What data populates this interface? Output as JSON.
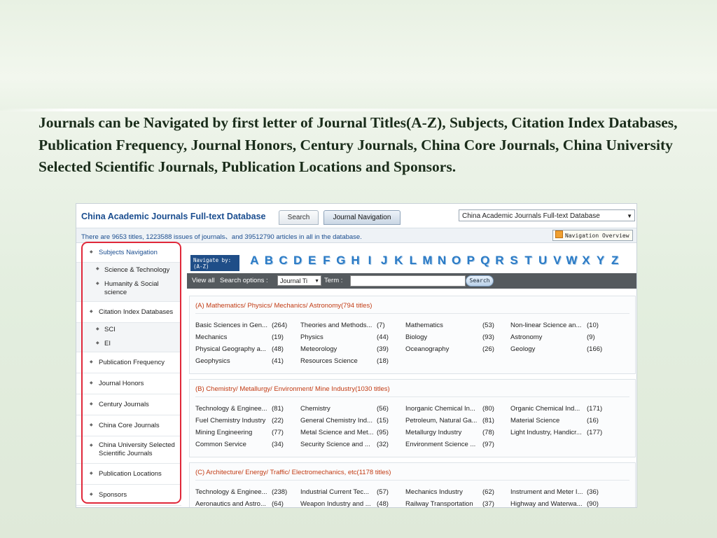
{
  "slide": {
    "heading": "Journals can be Navigated by first letter of Journal Titles(A-Z), Subjects, Citation Index Databases, Publication Frequency, Journal Honors, Century Journals, China Core Journals, China University Selected Scientific Journals, Publication Locations and Sponsors."
  },
  "header": {
    "db_title": "China Academic Journals Full-text Database",
    "tab_search": "Search",
    "tab_nav": "Journal Navigation",
    "db_select": "China Academic Journals Full-text Database"
  },
  "stats": {
    "text": "There are 9653 titles, 1223588 issues of journals、and 39512790 articles in all in the database.",
    "overview": "Navigation Overview"
  },
  "sidebar": {
    "items": [
      {
        "label": "Subjects Navigation"
      },
      {
        "label": "Science & Technology"
      },
      {
        "label": "Humanity & Social science"
      },
      {
        "label": "Citation Index Databases"
      },
      {
        "label": "SCI"
      },
      {
        "label": "EI"
      },
      {
        "label": "Publication Frequency"
      },
      {
        "label": "Journal Honors"
      },
      {
        "label": "Century Journals"
      },
      {
        "label": "China Core Journals"
      },
      {
        "label": "China University Selected Scientific Journals"
      },
      {
        "label": "Publication Locations"
      },
      {
        "label": "Sponsors"
      }
    ]
  },
  "nav": {
    "label_line1": "Navigate by:",
    "label_line2": "(A-Z)",
    "letters": [
      "A",
      "B",
      "C",
      "D",
      "E",
      "F",
      "G",
      "H",
      "I",
      "J",
      "K",
      "L",
      "M",
      "N",
      "O",
      "P",
      "Q",
      "R",
      "S",
      "T",
      "U",
      "V",
      "W",
      "X",
      "Y",
      "Z"
    ]
  },
  "toolbar": {
    "view_all": "View all",
    "search_options": "Search options :",
    "select_value": "Journal Ti",
    "term": "Term :",
    "search_btn": "Search"
  },
  "categories": [
    {
      "title": "(A) Mathematics/ Physics/ Mechanics/ Astronomy(794 titles)",
      "rows": [
        [
          [
            "Basic Sciences in Gen...",
            "(264)"
          ],
          [
            "Theories and Methods...",
            "(7)"
          ],
          [
            "Mathematics",
            "(53)"
          ],
          [
            "Non-linear Science an...",
            "(10)"
          ]
        ],
        [
          [
            "Mechanics",
            "(19)"
          ],
          [
            "Physics",
            "(44)"
          ],
          [
            "Biology",
            "(93)"
          ],
          [
            "Astronomy",
            "(9)"
          ]
        ],
        [
          [
            "Physical Geography a...",
            "(48)"
          ],
          [
            "Meteorology",
            "(39)"
          ],
          [
            "Oceanography",
            "(26)"
          ],
          [
            "Geology",
            "(166)"
          ]
        ],
        [
          [
            "Geophysics",
            "(41)"
          ],
          [
            "Resources Science",
            "(18)"
          ]
        ]
      ]
    },
    {
      "title": "(B) Chemistry/ Metallurgy/ Environment/ Mine Industry(1030 titles)",
      "rows": [
        [
          [
            "Technology & Enginee...",
            "(81)"
          ],
          [
            "Chemistry",
            "(56)"
          ],
          [
            "Inorganic Chemical In...",
            "(80)"
          ],
          [
            "Organic Chemical Ind...",
            "(171)"
          ]
        ],
        [
          [
            "Fuel Chemistry Industry",
            "(22)"
          ],
          [
            "General Chemistry Ind...",
            "(15)"
          ],
          [
            "Petroleum, Natural Ga...",
            "(81)"
          ],
          [
            "Material Science",
            "(16)"
          ]
        ],
        [
          [
            "Mining Engineering",
            "(77)"
          ],
          [
            "Metal Science and Met...",
            "(95)"
          ],
          [
            "Metallurgy Industry",
            "(78)"
          ],
          [
            "Light Industry, Handicr...",
            "(177)"
          ]
        ],
        [
          [
            "Common Service",
            "(34)"
          ],
          [
            "Security Science and ...",
            "(32)"
          ],
          [
            "Environment Science ...",
            "(97)"
          ]
        ]
      ]
    },
    {
      "title": "(C) Architecture/ Energy/ Traffic/ Electromechanics, etc(1178 titles)",
      "rows": [
        [
          [
            "Technology & Enginee...",
            "(238)"
          ],
          [
            "Industrial Current Tec...",
            "(57)"
          ],
          [
            "Mechanics Industry",
            "(62)"
          ],
          [
            "Instrument and Meter I...",
            "(36)"
          ]
        ],
        [
          [
            "Aeronautics and Astro...",
            "(64)"
          ],
          [
            "Weapon Industry and ...",
            "(48)"
          ],
          [
            "Railway Transportation",
            "(37)"
          ],
          [
            "Highway and Waterwa...",
            "(90)"
          ]
        ]
      ]
    }
  ]
}
